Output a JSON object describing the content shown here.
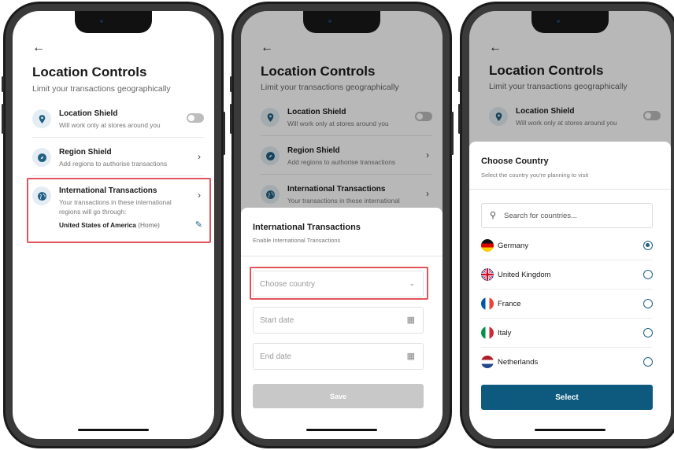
{
  "location_controls": {
    "back_label": "←",
    "title": "Location Controls",
    "subtitle": "Limit your transactions geographically",
    "location_shield": {
      "title": "Location Shield",
      "desc": "Will work only at stores around you"
    },
    "region_shield": {
      "title": "Region Shield",
      "desc": "Add regions to authorise transactions"
    },
    "international": {
      "title": "International Transactions",
      "desc": "Your transactions in these international regions will go through:",
      "desc_cut": "Your transactions in these international",
      "country": "United States of America",
      "country_tag": "(Home)"
    }
  },
  "enable_sheet": {
    "title": "International Transactions",
    "subtitle": "Enable International Transactions",
    "country_placeholder": "Choose country",
    "start_placeholder": "Start date",
    "end_placeholder": "End date",
    "save_label": "Save"
  },
  "country_sheet": {
    "title": "Choose Country",
    "subtitle": "Select the country you're planning to visit",
    "search_placeholder": "Search for countries...",
    "countries": [
      {
        "name": "Germany",
        "selected": true
      },
      {
        "name": "United Kingdom",
        "selected": false
      },
      {
        "name": "France",
        "selected": false
      },
      {
        "name": "Italy",
        "selected": false
      },
      {
        "name": "Netherlands",
        "selected": false
      }
    ],
    "select_label": "Select"
  },
  "colors": {
    "accent": "#0e5a7e",
    "highlight": "#e0555d",
    "icon_bg": "#e4edf3",
    "disabled_button": "#c8c8c8"
  }
}
